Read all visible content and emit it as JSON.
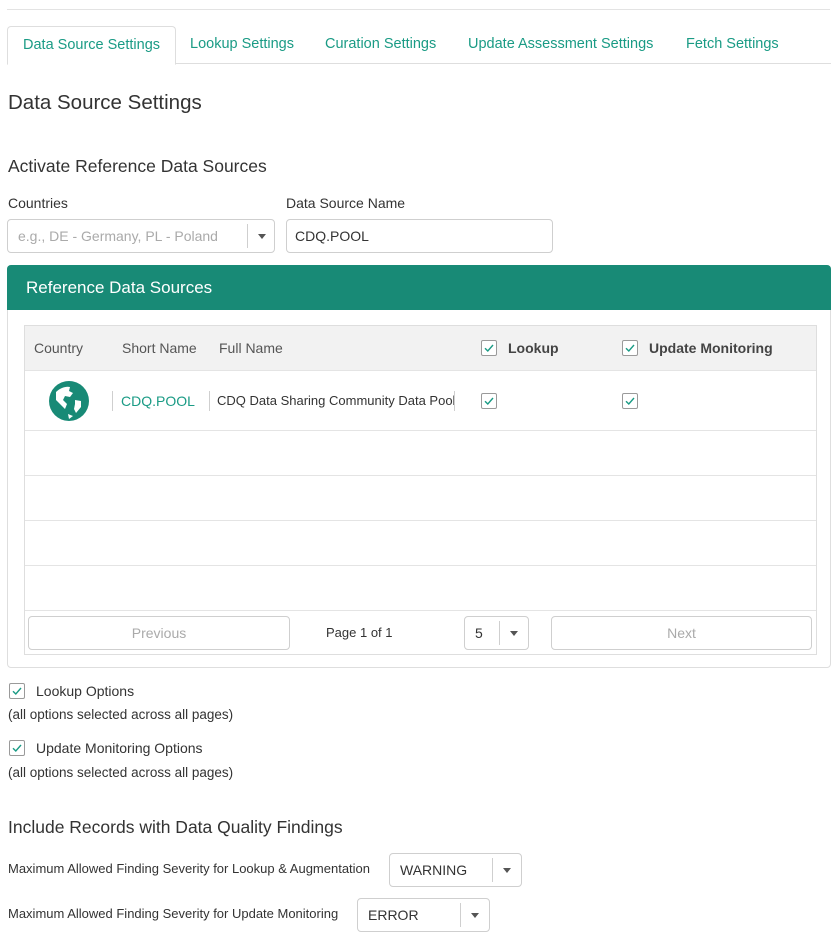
{
  "tabs": [
    {
      "label": "Data Source Settings",
      "active": true
    },
    {
      "label": "Lookup Settings"
    },
    {
      "label": "Curation Settings"
    },
    {
      "label": "Update Assessment Settings"
    },
    {
      "label": "Fetch Settings"
    }
  ],
  "page_title": "Data Source Settings",
  "activate": {
    "heading": "Activate Reference Data Sources",
    "countries_label": "Countries",
    "countries_placeholder": "e.g., DE - Germany, PL - Poland",
    "name_label": "Data Source Name",
    "name_value": "CDQ.POOL"
  },
  "panel": {
    "title": "Reference Data Sources",
    "columns": {
      "country": "Country",
      "short_name": "Short Name",
      "full_name": "Full Name",
      "lookup": "Lookup",
      "update_monitoring": "Update Monitoring"
    },
    "rows": [
      {
        "country_icon": "globe-icon",
        "short_name": "CDQ.POOL",
        "full_name": "CDQ Data Sharing Community Data Pool",
        "lookup": true,
        "update_monitoring": true
      }
    ],
    "pager": {
      "previous": "Previous",
      "page_info": "Page 1 of 1",
      "page_size": "5",
      "next": "Next"
    }
  },
  "options": {
    "lookup_label": "Lookup Options",
    "lookup_note": "(all options selected across all pages)",
    "monitoring_label": "Update Monitoring Options",
    "monitoring_note": "(all options selected across all pages)"
  },
  "quality": {
    "heading": "Include Records with Data Quality Findings",
    "lookup_label": "Maximum Allowed Finding Severity for Lookup & Augmentation",
    "lookup_value": "WARNING",
    "monitoring_label": "Maximum Allowed Finding Severity for Update Monitoring",
    "monitoring_value": "ERROR"
  },
  "colors": {
    "accent": "#1a9b85",
    "header": "#188a76"
  }
}
